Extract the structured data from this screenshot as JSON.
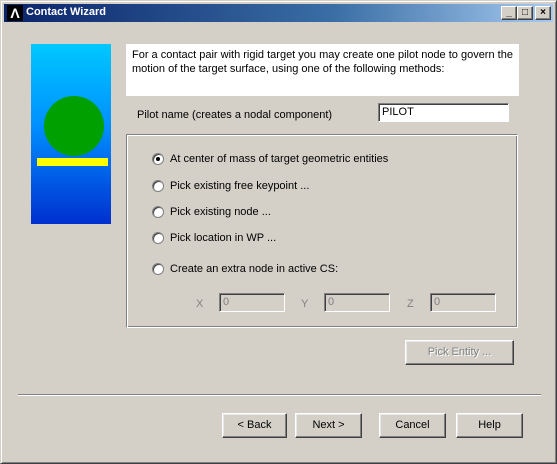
{
  "window": {
    "title": "Contact Wizard",
    "controls": [
      "_",
      "□",
      "×"
    ]
  },
  "description": "For a contact pair with rigid target you may create one pilot node to govern the motion of the target surface, using one of the following methods:",
  "pilot": {
    "label": "Pilot name (creates a nodal component)",
    "value": "PILOT"
  },
  "methods": [
    {
      "label": "At center of mass of target geometric entities",
      "selected": true
    },
    {
      "label": "Pick existing free keypoint ...",
      "selected": false
    },
    {
      "label": "Pick existing node ...",
      "selected": false
    },
    {
      "label": "Pick location in WP ...",
      "selected": false
    },
    {
      "label": "Create an extra node in active CS:",
      "selected": false
    }
  ],
  "coords": [
    {
      "label": "X",
      "value": "0"
    },
    {
      "label": "Y",
      "value": "0"
    },
    {
      "label": "Z",
      "value": "0"
    }
  ],
  "pick_entity_label": "Pick Entity ...",
  "buttons": {
    "back": "< Back",
    "next": "Next >",
    "cancel": "Cancel",
    "help": "Help"
  },
  "colors": {
    "title_bar": "#0a246a",
    "illustration_top": "#00c8ff",
    "illustration_bottom": "#0030d0",
    "circle": "#00a000",
    "target_bar": "#ffff00"
  }
}
